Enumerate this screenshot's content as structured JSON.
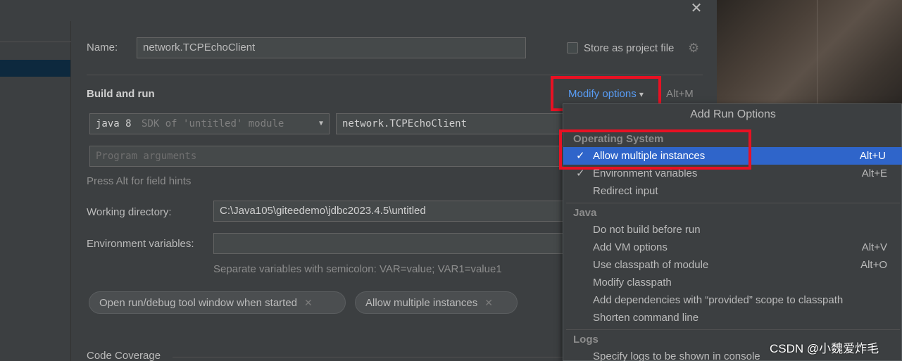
{
  "window": {
    "close_glyph": "✕"
  },
  "form": {
    "name_label": "Name:",
    "name_value": "network.TCPEchoClient",
    "store_label": "Store as project file",
    "build_run_title": "Build and run",
    "modify_options": "Modify options",
    "modify_options_shortcut": "Alt+M",
    "sdk_name": "java 8",
    "sdk_desc": "SDK of 'untitled' module",
    "main_class": "network.TCPEchoClient",
    "program_args_placeholder": "Program arguments",
    "field_hint": "Press Alt for field hints",
    "working_dir_label": "Working directory:",
    "working_dir_value": "C:\\Java105\\giteedemo\\jdbc2023.4.5\\untitled",
    "env_label": "Environment variables:",
    "env_value": "",
    "env_hint": "Separate variables with semicolon: VAR=value; VAR1=value1",
    "chips": [
      {
        "label": "Open run/debug tool window when started"
      },
      {
        "label": "Allow multiple instances"
      }
    ],
    "code_coverage": "Code Coverage"
  },
  "popup": {
    "title": "Add Run Options",
    "sections": [
      {
        "name": "Operating System",
        "items": [
          {
            "label": "Allow multiple instances",
            "shortcut": "Alt+U",
            "checked": true,
            "selected": true
          },
          {
            "label": "Environment variables",
            "shortcut": "Alt+E",
            "checked": true,
            "selected": false
          },
          {
            "label": "Redirect input",
            "shortcut": "",
            "checked": false,
            "selected": false
          }
        ]
      },
      {
        "name": "Java",
        "items": [
          {
            "label": "Do not build before run",
            "shortcut": "",
            "checked": false
          },
          {
            "label": "Add VM options",
            "shortcut": "Alt+V",
            "checked": false
          },
          {
            "label": "Use classpath of module",
            "shortcut": "Alt+O",
            "checked": false
          },
          {
            "label": "Modify classpath",
            "shortcut": "",
            "checked": false
          },
          {
            "label": "Add dependencies with “provided” scope to classpath",
            "shortcut": "",
            "checked": false
          },
          {
            "label": "Shorten command line",
            "shortcut": "",
            "checked": false
          }
        ]
      },
      {
        "name": "Logs",
        "items": [
          {
            "label": "Specify logs to be shown in console",
            "shortcut": "",
            "checked": false
          }
        ]
      }
    ]
  },
  "watermark": "CSDN @小魏爱炸毛",
  "icons": {
    "check": "✓",
    "gear": "⚙",
    "chevron": "⌄",
    "dropdown": "▼",
    "chip_close": "✕"
  },
  "colors": {
    "accent_link": "#589df6",
    "selection": "#2f65ca",
    "highlight_box": "#e81123"
  }
}
